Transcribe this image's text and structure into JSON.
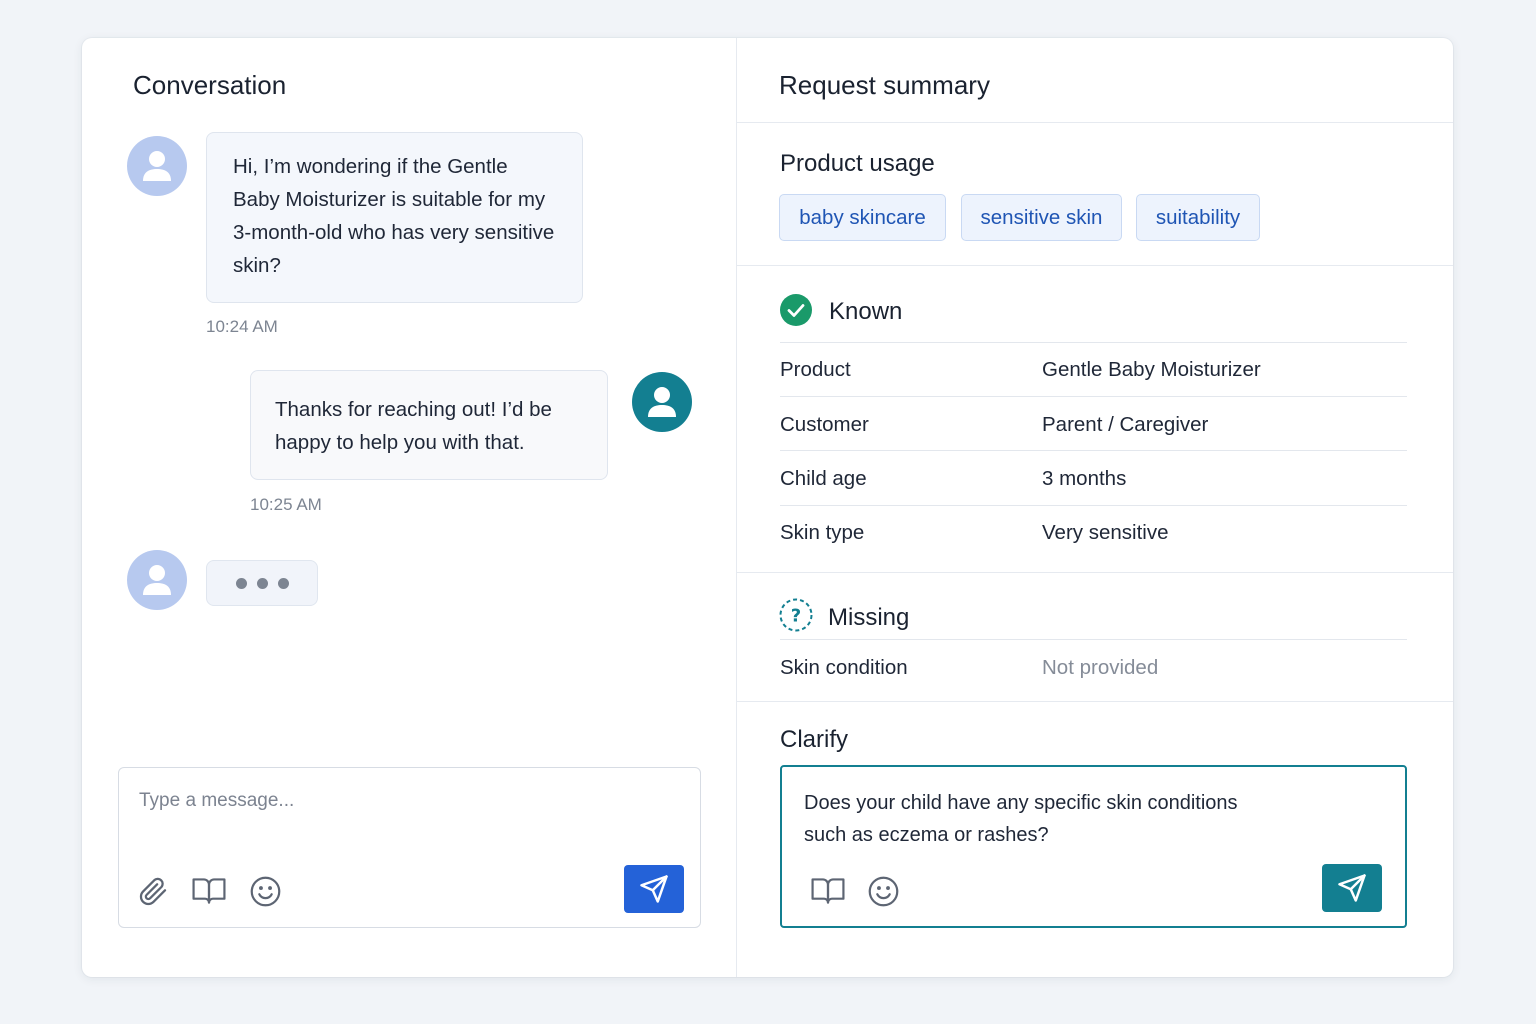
{
  "conversation": {
    "title": "Conversation",
    "messages": [
      {
        "sender": "customer",
        "text": "Hi, I’m wondering if the Gentle Baby Moisturizer is suitable for my 3-month-old who has very sensitive skin?",
        "time": "10:24 AM"
      },
      {
        "sender": "agent",
        "text": "Thanks for reaching out! I’d be happy to help you with that.",
        "time": "10:25 AM"
      }
    ],
    "composer": {
      "placeholder": "Type a message...",
      "icons": [
        "paperclip-icon",
        "book-icon",
        "smiley-icon"
      ],
      "send_icon": "send-icon"
    }
  },
  "summary": {
    "title": "Request summary",
    "usage": {
      "title": "Product usage",
      "tags": [
        "baby skincare",
        "sensitive skin",
        "suitability"
      ]
    },
    "known": {
      "label": "Known",
      "rows": [
        {
          "key": "Product",
          "value": "Gentle Baby Moisturizer"
        },
        {
          "key": "Customer",
          "value": "Parent / Caregiver"
        },
        {
          "key": "Child age",
          "value": "3 months"
        },
        {
          "key": "Skin type",
          "value": "Very sensitive"
        }
      ]
    },
    "missing": {
      "label": "Missing",
      "rows": [
        {
          "key": "Skin condition",
          "value": "Not provided"
        }
      ]
    },
    "clarify": {
      "title": "Clarify",
      "text": "Does your child have any specific skin conditions such as eczema or rashes?"
    }
  },
  "colors": {
    "accent_blue": "#2462d8",
    "accent_teal": "#137f91",
    "known_green": "#1a9a6a",
    "tag_text": "#1f55b4"
  }
}
